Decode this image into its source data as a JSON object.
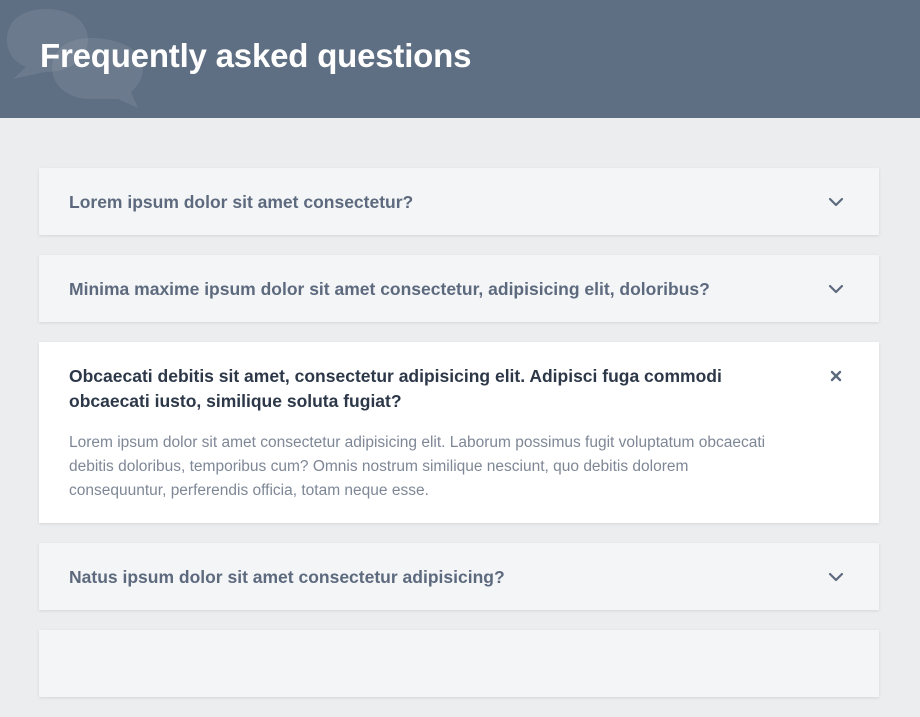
{
  "header": {
    "title": "Frequently asked questions",
    "icon": "speech-bubbles-icon"
  },
  "faq": [
    {
      "question": "Lorem ipsum dolor sit amet consectetur?",
      "state": "collapsed",
      "toggle_icon": "chevron-down-icon"
    },
    {
      "question": "Minima maxime ipsum dolor sit amet consectetur, adipisicing elit, doloribus?",
      "state": "collapsed",
      "toggle_icon": "chevron-down-icon"
    },
    {
      "question": "Obcaecati debitis sit amet, consectetur adipisicing elit. Adipisci fuga commodi obcaecati iusto, similique soluta fugiat?",
      "answer": "Lorem ipsum dolor sit amet consectetur adipisicing elit. Laborum possimus fugit voluptatum obcaecati debitis doloribus, temporibus cum? Omnis nostrum similique nesciunt, quo debitis dolorem consequuntur, perferendis officia, totam neque esse.",
      "state": "open",
      "toggle_icon": "close-icon"
    },
    {
      "question": "Natus ipsum dolor sit amet consectetur adipisicing?",
      "state": "collapsed",
      "toggle_icon": "chevron-down-icon"
    },
    {
      "question": "",
      "state": "collapsed",
      "toggle_icon": "chevron-down-icon"
    }
  ],
  "colors": {
    "header_bg": "#5f6f83",
    "page_bg": "#ebedef",
    "question_text": "#5d6a7e",
    "open_question_text": "#2c3748",
    "answer_text": "#7e8796"
  }
}
